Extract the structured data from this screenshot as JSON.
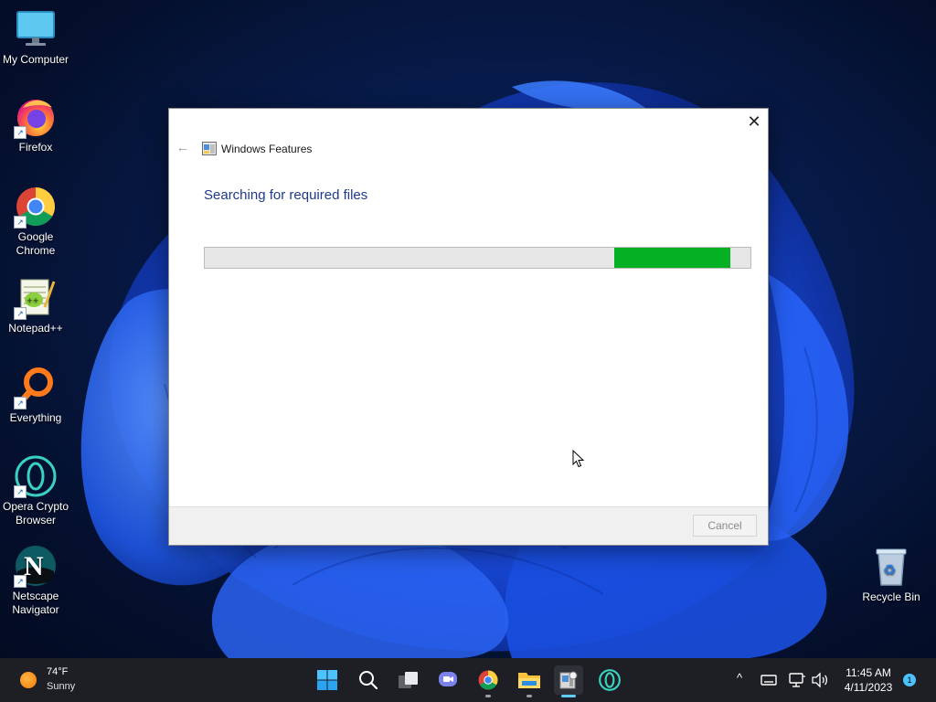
{
  "desktop": {
    "icons": [
      {
        "label": "My Computer",
        "icon": "monitor-icon",
        "shortcut": false
      },
      {
        "label": "Firefox",
        "icon": "firefox-icon",
        "shortcut": true
      },
      {
        "label": "Google Chrome",
        "icon": "chrome-icon",
        "shortcut": true
      },
      {
        "label": "Notepad++",
        "icon": "notepadpp-icon",
        "shortcut": true
      },
      {
        "label": "Everything",
        "icon": "everything-search-icon",
        "shortcut": true
      },
      {
        "label": "Opera Crypto Browser",
        "icon": "opera-icon",
        "shortcut": true
      },
      {
        "label": "Netscape Navigator",
        "icon": "netscape-icon",
        "shortcut": true
      }
    ],
    "recycle_bin": {
      "label": "Recycle Bin",
      "icon": "recycle-bin-icon"
    }
  },
  "dialog": {
    "title": "Windows Features",
    "heading": "Searching for required files",
    "progress": {
      "state": "indeterminate",
      "color": "#06b025"
    },
    "cancel_label": "Cancel",
    "close_glyph": "✕",
    "back_glyph": "←"
  },
  "taskbar": {
    "weather": {
      "temp": "74°F",
      "condition": "Sunny",
      "icon": "sun-icon"
    },
    "apps": [
      {
        "name": "start",
        "icon": "windows-start-icon"
      },
      {
        "name": "search",
        "icon": "search-icon"
      },
      {
        "name": "task-view",
        "icon": "task-view-icon"
      },
      {
        "name": "teams-chat",
        "icon": "chat-icon"
      },
      {
        "name": "chrome",
        "icon": "chrome-icon",
        "running": true
      },
      {
        "name": "file-explorer",
        "icon": "folder-icon",
        "running": true
      },
      {
        "name": "windows-features",
        "icon": "windows-features-icon",
        "running": true,
        "active": true
      },
      {
        "name": "opera",
        "icon": "opera-icon"
      }
    ],
    "tray": {
      "chevron": "^",
      "clock_time": "11:45 AM",
      "clock_date": "4/11/2023",
      "notifications": "1"
    }
  },
  "colors": {
    "accent": "#60cdff",
    "dialog_heading": "#1e3a8a",
    "progress_green": "#06b025",
    "taskbar_bg": "#1e1f24"
  }
}
